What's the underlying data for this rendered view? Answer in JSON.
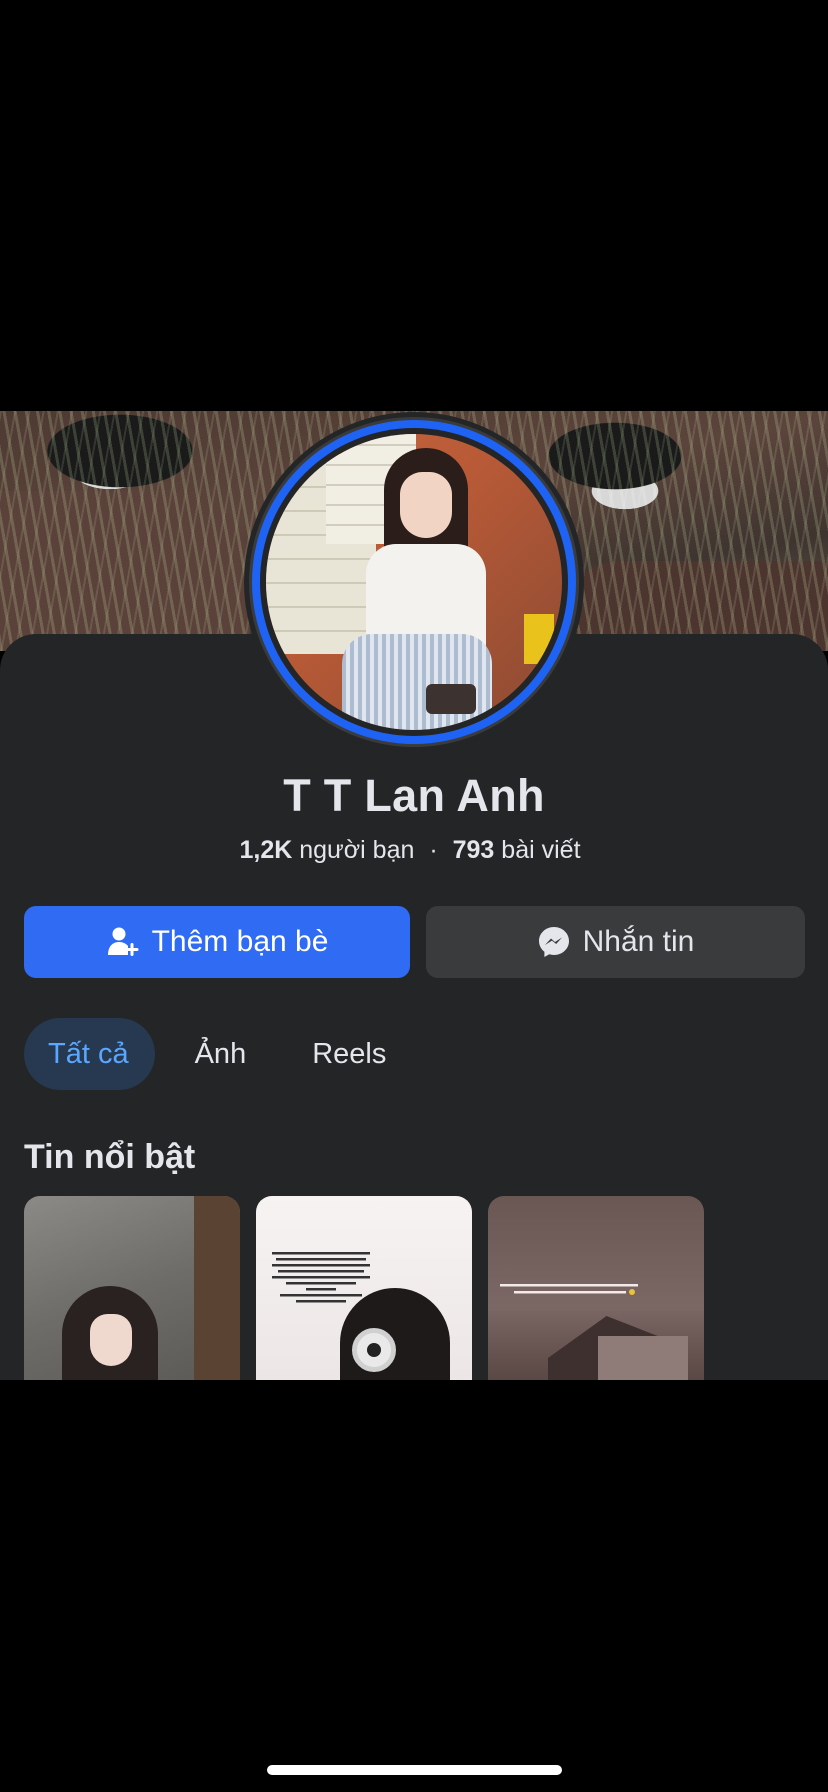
{
  "profile": {
    "name": "T T Lan Anh",
    "friends_count": "1,2K",
    "friends_label": "người bạn",
    "separator": "·",
    "posts_count": "793",
    "posts_label": "bài viết"
  },
  "actions": {
    "add_friend_label": "Thêm bạn bè",
    "add_friend_icon": "add-friend-icon",
    "message_label": "Nhắn tin",
    "message_icon": "messenger-icon"
  },
  "tabs": [
    {
      "label": "Tất cả",
      "active": true
    },
    {
      "label": "Ảnh",
      "active": false
    },
    {
      "label": "Reels",
      "active": false
    }
  ],
  "highlights": {
    "title": "Tin nổi bật"
  },
  "colors": {
    "background": "#000000",
    "card": "#242526",
    "primary_button": "#2f6bf3",
    "secondary_button": "#3a3b3c",
    "active_tab_bg": "#263951",
    "active_tab_text": "#5aa7ff",
    "avatar_ring": "#1f63f5"
  }
}
